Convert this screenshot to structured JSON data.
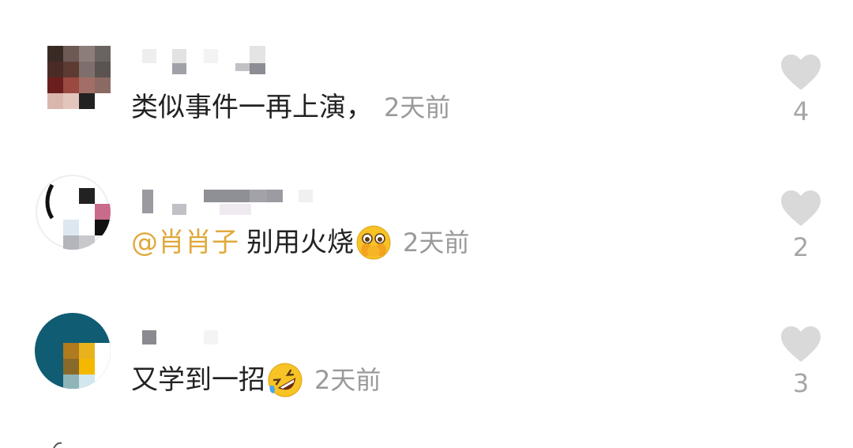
{
  "comments": [
    {
      "text": "类似事件一再上演，",
      "mention": "",
      "time": "2天前",
      "likes": "4",
      "emoji": ""
    },
    {
      "text": "别用火烧",
      "mention": "@肖肖子",
      "time": "2天前",
      "likes": "2",
      "emoji": "covering-mouth-emoji-icon"
    },
    {
      "text": "又学到一招",
      "mention": "",
      "time": "2天前",
      "likes": "3",
      "emoji": "rolling-laugh-emoji-icon"
    }
  ],
  "colors": {
    "mention": "#e0a93b",
    "time": "#9a9a9a",
    "heart": "#d9d9d9",
    "text": "#222222"
  }
}
